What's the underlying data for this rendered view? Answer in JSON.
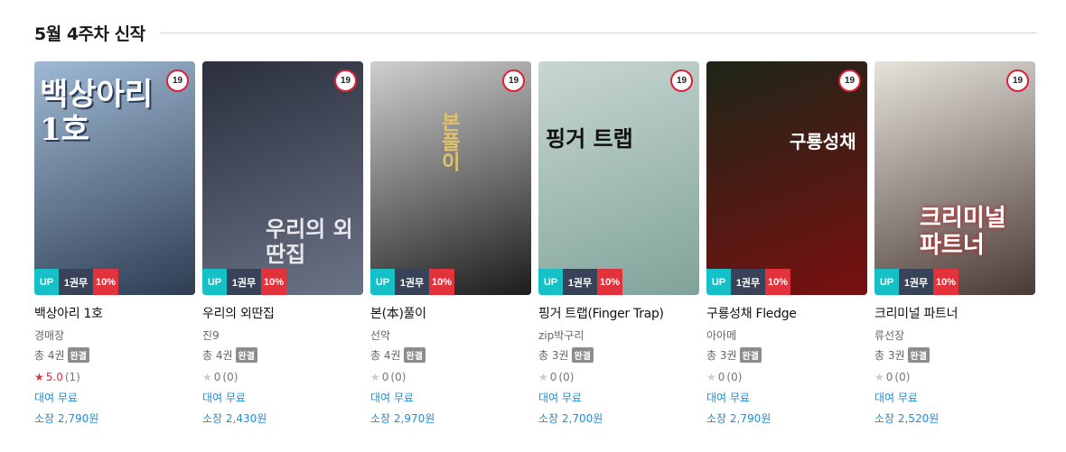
{
  "section": {
    "title": "5월 4주차 신작"
  },
  "books": [
    {
      "title": "백상아리 1호",
      "author": "경매장",
      "volumes": "총 4권",
      "status": "완결",
      "rating": "5.0",
      "rating_count": "(1)",
      "rated": true,
      "rent": "대여 무료",
      "price": "소장 2,790원",
      "age": "19",
      "badge_up": "UP",
      "badge_series": "1권무",
      "badge_discount": "10%",
      "cover_text": "백상아리 1호",
      "cover_colors": [
        "#9fb9d4",
        "#2e3d52"
      ]
    },
    {
      "title": "우리의 외딴집",
      "author": "진9",
      "volumes": "총 4권",
      "status": "완결",
      "rating": "0",
      "rating_count": "(0)",
      "rated": false,
      "rent": "대여 무료",
      "price": "소장 2,430원",
      "age": "19",
      "badge_up": "UP",
      "badge_series": "1권무",
      "badge_discount": "10%",
      "cover_text": "우리의 외딴집",
      "cover_colors": [
        "#2b2f3d",
        "#6b7386"
      ]
    },
    {
      "title": "본(本)풀이",
      "author": "선악",
      "volumes": "총 4권",
      "status": "완결",
      "rating": "0",
      "rating_count": "(0)",
      "rated": false,
      "rent": "대여 무료",
      "price": "소장 2,970원",
      "age": "19",
      "badge_up": "UP",
      "badge_series": "1권무",
      "badge_discount": "10%",
      "cover_text": "본풀이",
      "cover_colors": [
        "#cfcfcf",
        "#1c1c1c"
      ]
    },
    {
      "title": "핑거 트랩(Finger Trap)",
      "author": "zip박구리",
      "volumes": "총 3권",
      "status": "완결",
      "rating": "0",
      "rating_count": "(0)",
      "rated": false,
      "rent": "대여 무료",
      "price": "소장 2,700원",
      "age": "19",
      "badge_up": "UP",
      "badge_series": "1권무",
      "badge_discount": "10%",
      "cover_text": "핑거 트랩",
      "cover_colors": [
        "#c9d6d2",
        "#7fa39a"
      ]
    },
    {
      "title": "구룡성채 Fledge",
      "author": "아아메",
      "volumes": "총 3권",
      "status": "완결",
      "rating": "0",
      "rating_count": "(0)",
      "rated": false,
      "rent": "대여 무료",
      "price": "소장 2,790원",
      "age": "19",
      "badge_up": "UP",
      "badge_series": "1권무",
      "badge_discount": "10%",
      "cover_text": "구룡성채",
      "cover_colors": [
        "#1d2618",
        "#7a1010"
      ]
    },
    {
      "title": "크리미널 파트너",
      "author": "류선장",
      "volumes": "총 3권",
      "status": "완결",
      "rating": "0",
      "rating_count": "(0)",
      "rated": false,
      "rent": "대여 무료",
      "price": "소장 2,520원",
      "age": "19",
      "badge_up": "UP",
      "badge_series": "1권무",
      "badge_discount": "10%",
      "cover_text": "크리미널 파트너",
      "cover_colors": [
        "#e6e2dc",
        "#4a3a36"
      ]
    }
  ]
}
